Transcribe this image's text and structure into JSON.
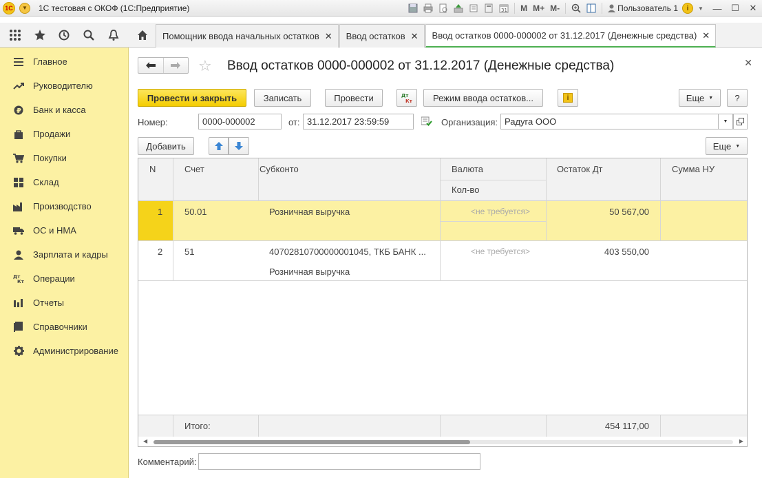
{
  "window": {
    "title": "1С тестовая с ОКОФ  (1С:Предприятие)",
    "toolbar_m": "M",
    "toolbar_mplus": "M+",
    "toolbar_mminus": "M-",
    "user": "Пользователь 1",
    "calendar_day": "31"
  },
  "tabs": [
    {
      "label": "Помощник ввода начальных остатков"
    },
    {
      "label": "Ввод остатков"
    },
    {
      "label": "Ввод остатков 0000-000002 от 31.12.2017 (Денежные средства)"
    }
  ],
  "sidebar": {
    "items": [
      {
        "label": "Главное",
        "icon": "menu-icon"
      },
      {
        "label": "Руководителю",
        "icon": "trend-icon"
      },
      {
        "label": "Банк и касса",
        "icon": "ruble-icon"
      },
      {
        "label": "Продажи",
        "icon": "bag-icon"
      },
      {
        "label": "Покупки",
        "icon": "cart-icon"
      },
      {
        "label": "Склад",
        "icon": "warehouse-icon"
      },
      {
        "label": "Производство",
        "icon": "factory-icon"
      },
      {
        "label": "ОС и НМА",
        "icon": "truck-icon"
      },
      {
        "label": "Зарплата и кадры",
        "icon": "person-icon"
      },
      {
        "label": "Операции",
        "icon": "dt-kt-icon"
      },
      {
        "label": "Отчеты",
        "icon": "bar-chart-icon"
      },
      {
        "label": "Справочники",
        "icon": "book-icon"
      },
      {
        "label": "Администрирование",
        "icon": "gear-icon"
      }
    ]
  },
  "document": {
    "title": "Ввод остатков 0000-000002 от 31.12.2017 (Денежные средства)",
    "buttons": {
      "post_close": "Провести и закрыть",
      "save": "Записать",
      "post": "Провести",
      "dtkt_top": "Дт",
      "dtkt_bottom": "Кт",
      "mode": "Режим ввода остатков...",
      "info": "i",
      "more": "Еще",
      "help": "?",
      "add": "Добавить",
      "more2": "Еще"
    },
    "fields": {
      "number_label": "Номер:",
      "number_value": "0000-000002",
      "date_label": "от:",
      "date_value": "31.12.2017 23:59:59",
      "org_label": "Организация:",
      "org_value": "Радуга ООО"
    },
    "comment_label": "Комментарий:",
    "comment_value": ""
  },
  "table": {
    "headers": {
      "n": "N",
      "account": "Счет",
      "subkonto": "Субконто",
      "currency": "Валюта",
      "qty": "Кол-во",
      "balance_dt": "Остаток Дт",
      "sum_nu": "Сумма НУ"
    },
    "rows": [
      {
        "n": "1",
        "account": "50.01",
        "subkonto1": "Розничная выручка",
        "subkonto2": "",
        "currency": "<не требуется>",
        "balance_dt": "50 567,00"
      },
      {
        "n": "2",
        "account": "51",
        "subkonto1": "40702810700000001045, ТКБ БАНК ...",
        "subkonto2": "Розничная выручка",
        "currency": "<не требуется>",
        "balance_dt": "403 550,00"
      }
    ],
    "footer": {
      "label": "Итого:",
      "balance_dt": "454 117,00"
    }
  }
}
